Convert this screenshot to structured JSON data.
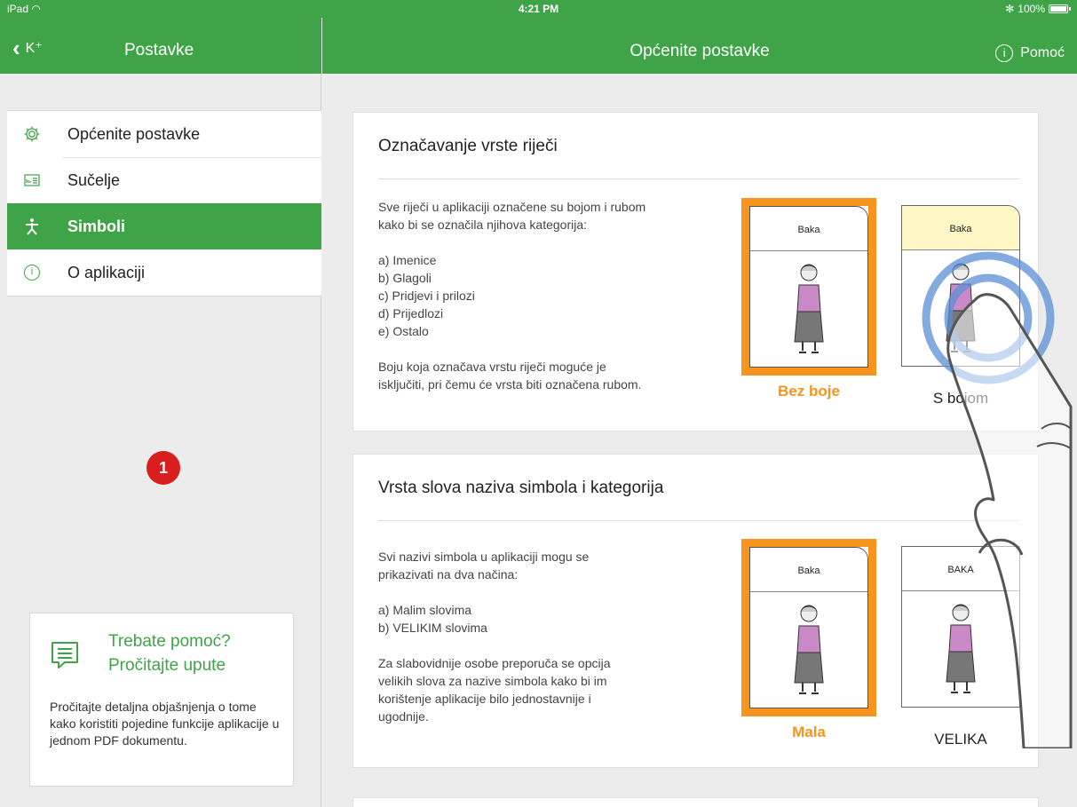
{
  "status": {
    "device": "iPad",
    "time": "4:21 PM",
    "battery": "100%"
  },
  "nav_left": {
    "back_label": "K⁺",
    "title": "Postavke"
  },
  "nav_right": {
    "title": "Općenite postavke",
    "help_label": "Pomoć"
  },
  "sidebar": {
    "items": [
      {
        "label": "Općenite postavke",
        "icon": "gear-icon",
        "active": false
      },
      {
        "label": "Sučelje",
        "icon": "interface-icon",
        "active": false
      },
      {
        "label": "Simboli",
        "icon": "symbol-icon",
        "active": true
      },
      {
        "label": "O aplikaciji",
        "icon": "info-icon",
        "active": false
      }
    ],
    "badge": "1",
    "help_card": {
      "title_line1": "Trebate pomoć?",
      "title_line2": "Pročitajte upute",
      "text": "Pročitajte detaljna objašnjenja o tome kako koristiti pojedine funkcije aplikacije u jednom PDF dokumentu."
    }
  },
  "sections": [
    {
      "title": "Označavanje vrste riječi",
      "description": "Sve riječi u aplikaciji označene su bojom i rubom\nkako bi se označila njihova kategorija:\n\na) Imenice\nb) Glagoli\nc) Pridjevi i prilozi\nd) Prijedlozi\ne) Ostalo\n\nBoju koja označava vrstu riječi moguće je\nisključiti, pri čemu će vrsta biti označena rubom.",
      "options": [
        {
          "card_label": "Baka",
          "caption": "Bez boje",
          "selected": true
        },
        {
          "card_label": "Baka",
          "caption": "S bojom",
          "selected": false
        }
      ]
    },
    {
      "title": "Vrsta slova naziva simbola i kategorija",
      "description": "Svi nazivi simbola u aplikaciji mogu se\nprikazivati na dva načina:\n\na) Malim slovima\nb) VELIKIM slovima\n\nZa slabovidnije osobe preporuča se opcija\nvelikih slova za nazive simbola kako bi im\nkorištenje aplikacije bilo jednostavnije i\nugodnije.",
      "options": [
        {
          "card_label": "Baka",
          "caption": "Mala",
          "selected": true
        },
        {
          "card_label": "BAKA",
          "caption": "VELIKA",
          "selected": false
        }
      ]
    }
  ],
  "colors": {
    "brand_green": "#3fa447",
    "selected_orange": "#f7941d",
    "badge_red": "#d81e1e",
    "yellow_label": "#fff8c6"
  }
}
